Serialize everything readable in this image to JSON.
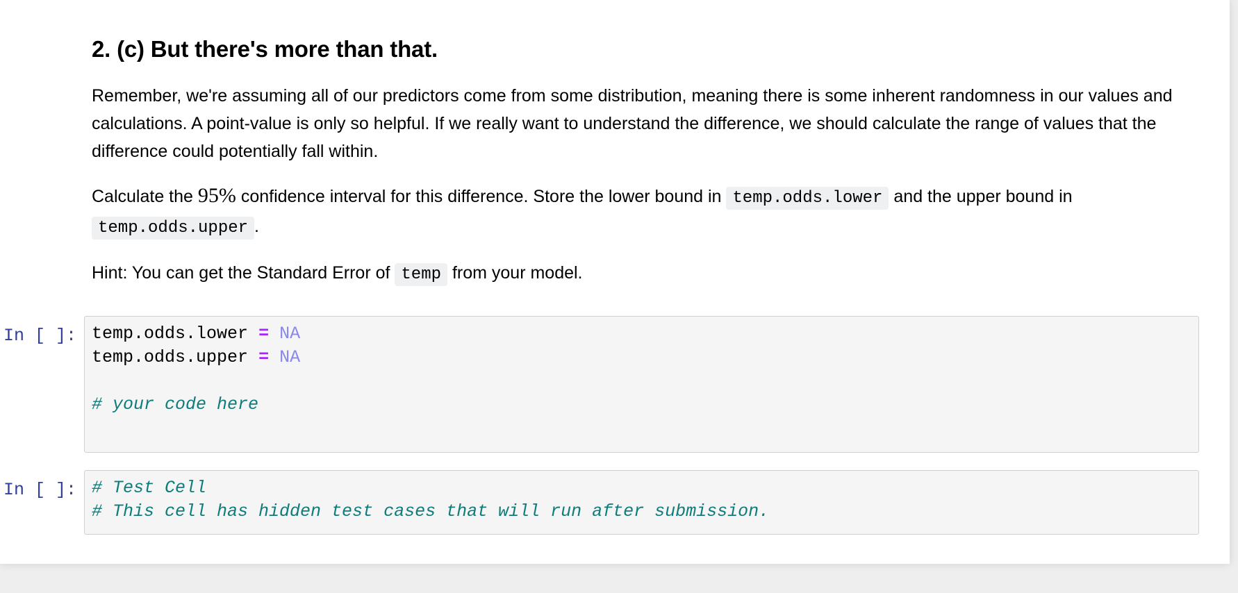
{
  "markdown": {
    "heading": "2. (c) But there's more than that.",
    "paragraph1": "Remember, we're assuming all of our predictors come from some distribution, meaning there is some inherent randomness in our values and calculations. A point-value is only so helpful. If we really want to understand the difference, we should calculate the range of values that the difference could potentially fall within.",
    "paragraph2": {
      "text_before_number": "Calculate the ",
      "number": "95%",
      "text_after_number": " confidence interval for this difference. Store the lower bound in ",
      "code_lower": "temp.odds.lower",
      "text_middle": " and the upper bound in ",
      "code_upper": "temp.odds.upper",
      "text_end": "."
    },
    "paragraph3": {
      "text_before": "Hint: You can get the Standard Error of ",
      "code": "temp",
      "text_after": " from your model."
    }
  },
  "cells": [
    {
      "prompt": "In [ ]:",
      "lines": [
        {
          "var": "temp.odds.lower",
          "op": "=",
          "value": "NA"
        },
        {
          "var": "temp.odds.upper",
          "op": "=",
          "value": "NA"
        }
      ],
      "comment": "# your code here"
    },
    {
      "prompt": "In [ ]:",
      "comments": [
        "# Test Cell",
        "# This cell has hidden test cases that will run after submission."
      ]
    }
  ]
}
